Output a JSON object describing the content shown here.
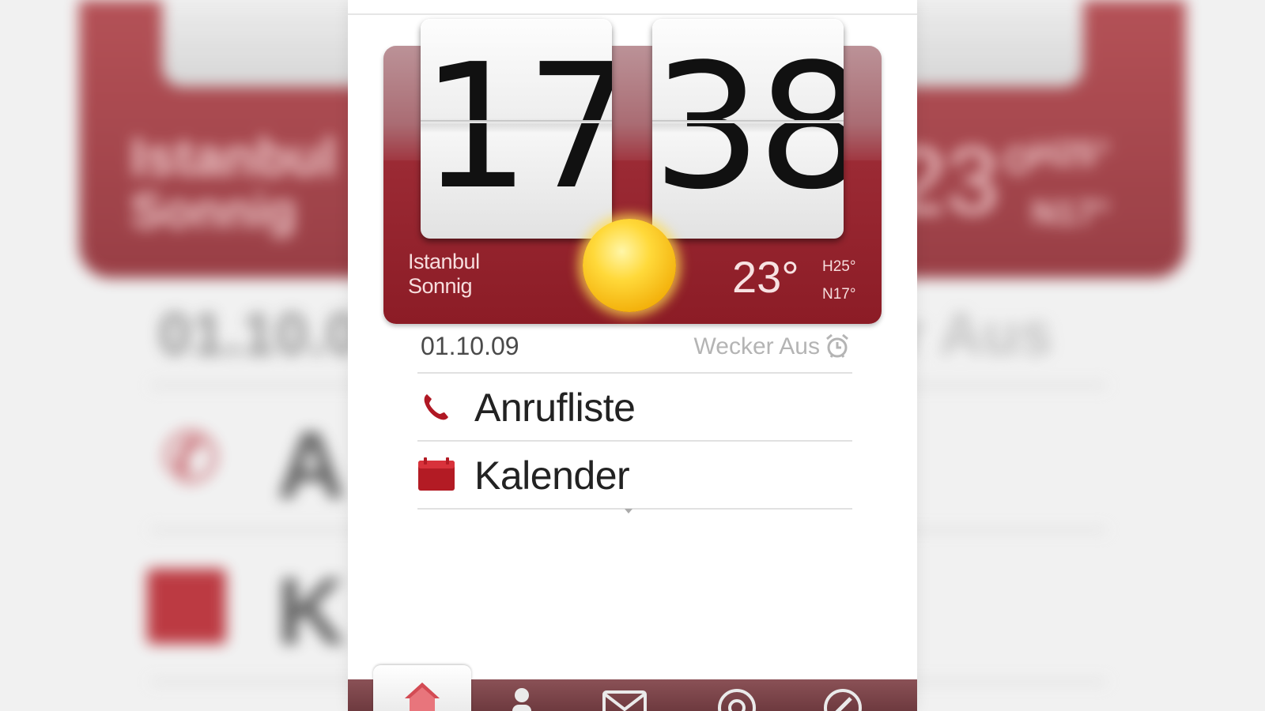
{
  "clock": {
    "hours": "17",
    "minutes": "38"
  },
  "weather": {
    "city": "Istanbul",
    "condition": "Sonnig",
    "temperature": "23°",
    "high": "H25°",
    "low": "N17°",
    "icon": "sun-icon"
  },
  "status": {
    "date": "01.10.09",
    "alarm": "Wecker Aus",
    "alarm_icon": "alarm-clock-icon"
  },
  "list": {
    "items": [
      {
        "label": "Anrufliste",
        "icon": "phone-icon"
      },
      {
        "label": "Kalender",
        "icon": "calendar-icon"
      }
    ]
  },
  "tabs": [
    {
      "name": "home",
      "icon": "home-icon",
      "selected": true
    },
    {
      "name": "people",
      "icon": "person-icon"
    },
    {
      "name": "messages",
      "icon": "mail-icon"
    },
    {
      "name": "internet",
      "icon": "globe-icon"
    },
    {
      "name": "settings",
      "icon": "tools-icon"
    }
  ],
  "background_partial_text": {
    "left_date": "01.10.0",
    "right_alarm": "r Aus",
    "left_call": "A",
    "left_calendar": "K"
  },
  "colors": {
    "accent": "#8c1c26",
    "widget_top": "#a8737a",
    "text_dark": "#222222"
  }
}
